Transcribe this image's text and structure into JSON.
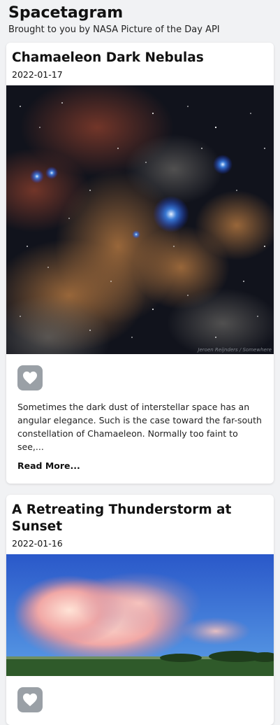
{
  "app": {
    "title": "Spacetagram",
    "subtitle": "Brought to you by NASA Picture of the Day API"
  },
  "posts": [
    {
      "title": "Chamaeleon Dark Nebulas",
      "date": "2022-01-17",
      "description": "Sometimes the dark dust of interstellar space has an angular elegance. Such is the case toward the far-south constellation of Chamaeleon. Normally too faint to see,...",
      "read_more": "Read More...",
      "like_icon": "heart-icon",
      "image_credit": "Jeroen Reijnders / Somewhere"
    },
    {
      "title": "A Retreating Thunderstorm at Sunset",
      "date": "2022-01-16",
      "like_icon": "heart-icon"
    }
  ],
  "colors": {
    "background": "#f1f2f4",
    "card": "#ffffff",
    "like_button": "#9aa0a6"
  }
}
